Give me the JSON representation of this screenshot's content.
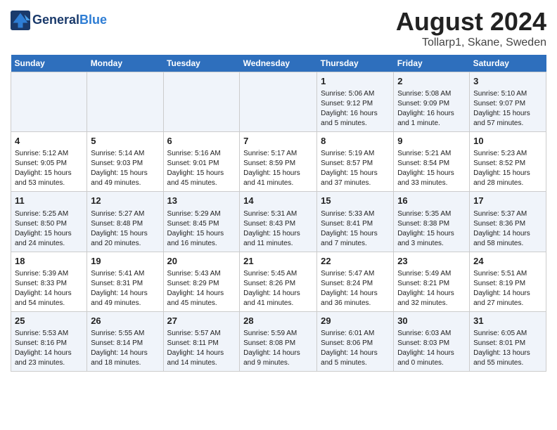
{
  "header": {
    "logo_line1": "General",
    "logo_line2": "Blue",
    "main_title": "August 2024",
    "subtitle": "Tollarp1, Skane, Sweden"
  },
  "weekdays": [
    "Sunday",
    "Monday",
    "Tuesday",
    "Wednesday",
    "Thursday",
    "Friday",
    "Saturday"
  ],
  "weeks": [
    [
      {
        "day": "",
        "content": ""
      },
      {
        "day": "",
        "content": ""
      },
      {
        "day": "",
        "content": ""
      },
      {
        "day": "",
        "content": ""
      },
      {
        "day": "1",
        "content": "Sunrise: 5:06 AM\nSunset: 9:12 PM\nDaylight: 16 hours\nand 5 minutes."
      },
      {
        "day": "2",
        "content": "Sunrise: 5:08 AM\nSunset: 9:09 PM\nDaylight: 16 hours\nand 1 minute."
      },
      {
        "day": "3",
        "content": "Sunrise: 5:10 AM\nSunset: 9:07 PM\nDaylight: 15 hours\nand 57 minutes."
      }
    ],
    [
      {
        "day": "4",
        "content": "Sunrise: 5:12 AM\nSunset: 9:05 PM\nDaylight: 15 hours\nand 53 minutes."
      },
      {
        "day": "5",
        "content": "Sunrise: 5:14 AM\nSunset: 9:03 PM\nDaylight: 15 hours\nand 49 minutes."
      },
      {
        "day": "6",
        "content": "Sunrise: 5:16 AM\nSunset: 9:01 PM\nDaylight: 15 hours\nand 45 minutes."
      },
      {
        "day": "7",
        "content": "Sunrise: 5:17 AM\nSunset: 8:59 PM\nDaylight: 15 hours\nand 41 minutes."
      },
      {
        "day": "8",
        "content": "Sunrise: 5:19 AM\nSunset: 8:57 PM\nDaylight: 15 hours\nand 37 minutes."
      },
      {
        "day": "9",
        "content": "Sunrise: 5:21 AM\nSunset: 8:54 PM\nDaylight: 15 hours\nand 33 minutes."
      },
      {
        "day": "10",
        "content": "Sunrise: 5:23 AM\nSunset: 8:52 PM\nDaylight: 15 hours\nand 28 minutes."
      }
    ],
    [
      {
        "day": "11",
        "content": "Sunrise: 5:25 AM\nSunset: 8:50 PM\nDaylight: 15 hours\nand 24 minutes."
      },
      {
        "day": "12",
        "content": "Sunrise: 5:27 AM\nSunset: 8:48 PM\nDaylight: 15 hours\nand 20 minutes."
      },
      {
        "day": "13",
        "content": "Sunrise: 5:29 AM\nSunset: 8:45 PM\nDaylight: 15 hours\nand 16 minutes."
      },
      {
        "day": "14",
        "content": "Sunrise: 5:31 AM\nSunset: 8:43 PM\nDaylight: 15 hours\nand 11 minutes."
      },
      {
        "day": "15",
        "content": "Sunrise: 5:33 AM\nSunset: 8:41 PM\nDaylight: 15 hours\nand 7 minutes."
      },
      {
        "day": "16",
        "content": "Sunrise: 5:35 AM\nSunset: 8:38 PM\nDaylight: 15 hours\nand 3 minutes."
      },
      {
        "day": "17",
        "content": "Sunrise: 5:37 AM\nSunset: 8:36 PM\nDaylight: 14 hours\nand 58 minutes."
      }
    ],
    [
      {
        "day": "18",
        "content": "Sunrise: 5:39 AM\nSunset: 8:33 PM\nDaylight: 14 hours\nand 54 minutes."
      },
      {
        "day": "19",
        "content": "Sunrise: 5:41 AM\nSunset: 8:31 PM\nDaylight: 14 hours\nand 49 minutes."
      },
      {
        "day": "20",
        "content": "Sunrise: 5:43 AM\nSunset: 8:29 PM\nDaylight: 14 hours\nand 45 minutes."
      },
      {
        "day": "21",
        "content": "Sunrise: 5:45 AM\nSunset: 8:26 PM\nDaylight: 14 hours\nand 41 minutes."
      },
      {
        "day": "22",
        "content": "Sunrise: 5:47 AM\nSunset: 8:24 PM\nDaylight: 14 hours\nand 36 minutes."
      },
      {
        "day": "23",
        "content": "Sunrise: 5:49 AM\nSunset: 8:21 PM\nDaylight: 14 hours\nand 32 minutes."
      },
      {
        "day": "24",
        "content": "Sunrise: 5:51 AM\nSunset: 8:19 PM\nDaylight: 14 hours\nand 27 minutes."
      }
    ],
    [
      {
        "day": "25",
        "content": "Sunrise: 5:53 AM\nSunset: 8:16 PM\nDaylight: 14 hours\nand 23 minutes."
      },
      {
        "day": "26",
        "content": "Sunrise: 5:55 AM\nSunset: 8:14 PM\nDaylight: 14 hours\nand 18 minutes."
      },
      {
        "day": "27",
        "content": "Sunrise: 5:57 AM\nSunset: 8:11 PM\nDaylight: 14 hours\nand 14 minutes."
      },
      {
        "day": "28",
        "content": "Sunrise: 5:59 AM\nSunset: 8:08 PM\nDaylight: 14 hours\nand 9 minutes."
      },
      {
        "day": "29",
        "content": "Sunrise: 6:01 AM\nSunset: 8:06 PM\nDaylight: 14 hours\nand 5 minutes."
      },
      {
        "day": "30",
        "content": "Sunrise: 6:03 AM\nSunset: 8:03 PM\nDaylight: 14 hours\nand 0 minutes."
      },
      {
        "day": "31",
        "content": "Sunrise: 6:05 AM\nSunset: 8:01 PM\nDaylight: 13 hours\nand 55 minutes."
      }
    ]
  ]
}
